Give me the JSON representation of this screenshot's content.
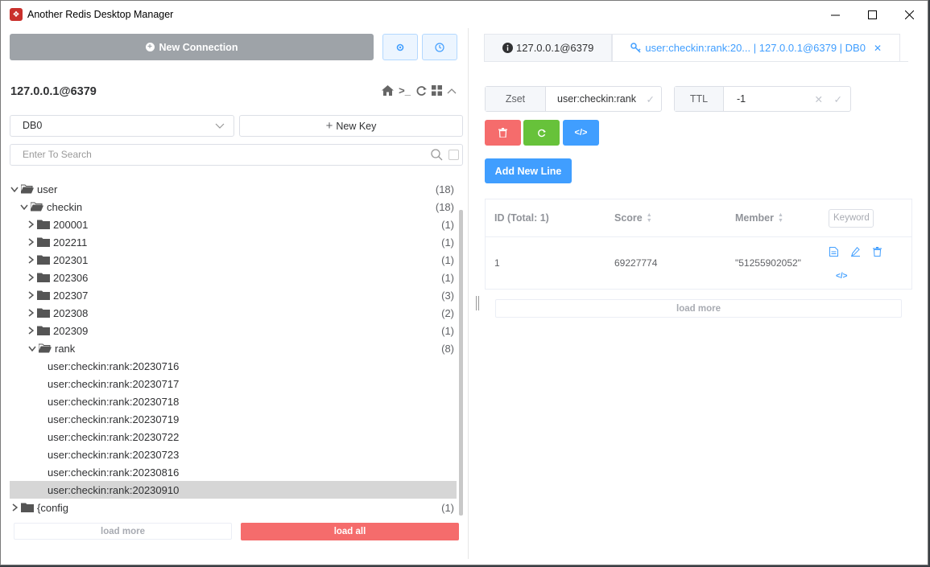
{
  "window": {
    "title": "Another Redis Desktop Manager"
  },
  "sidebar": {
    "new_connection_label": "New Connection",
    "connection_name": "127.0.0.1@6379",
    "db_select": "DB0",
    "new_key_label": "New Key",
    "search_placeholder": "Enter To Search",
    "tree": [
      {
        "label": "user",
        "count": "(18)"
      },
      {
        "label": "checkin",
        "count": "(18)"
      },
      {
        "label": "200001",
        "count": "(1)"
      },
      {
        "label": "202211",
        "count": "(1)"
      },
      {
        "label": "202301",
        "count": "(1)"
      },
      {
        "label": "202306",
        "count": "(1)"
      },
      {
        "label": "202307",
        "count": "(3)"
      },
      {
        "label": "202308",
        "count": "(2)"
      },
      {
        "label": "202309",
        "count": "(1)"
      },
      {
        "label": "rank",
        "count": "(8)"
      },
      {
        "label": "user:checkin:rank:20230716"
      },
      {
        "label": "user:checkin:rank:20230717"
      },
      {
        "label": "user:checkin:rank:20230718"
      },
      {
        "label": "user:checkin:rank:20230719"
      },
      {
        "label": "user:checkin:rank:20230722"
      },
      {
        "label": "user:checkin:rank:20230723"
      },
      {
        "label": "user:checkin:rank:20230816"
      },
      {
        "label": "user:checkin:rank:20230910"
      },
      {
        "label": "{config",
        "count": "(1)"
      }
    ],
    "load_more_label": "load more",
    "load_all_label": "load all"
  },
  "main": {
    "tabs": [
      {
        "label": "127.0.0.1@6379"
      },
      {
        "label": "user:checkin:rank:20... | 127.0.0.1@6379 | DB0"
      }
    ],
    "key_type": "Zset",
    "key_name": "user:checkin:rank",
    "ttl_label": "TTL",
    "ttl_value": "-1",
    "add_new_line_label": "Add New Line",
    "table": {
      "col_id": "ID (Total: 1)",
      "col_score": "Score",
      "col_member": "Member",
      "keyword_placeholder": "Keyword",
      "rows": [
        {
          "id": "1",
          "score": "69227774",
          "member": "\"51255902052\""
        }
      ]
    },
    "load_more_label": "load more"
  },
  "colors": {
    "accent": "#409eff",
    "danger": "#f56c6c",
    "success": "#67c23a",
    "gray_button": "#9ea3a8"
  }
}
